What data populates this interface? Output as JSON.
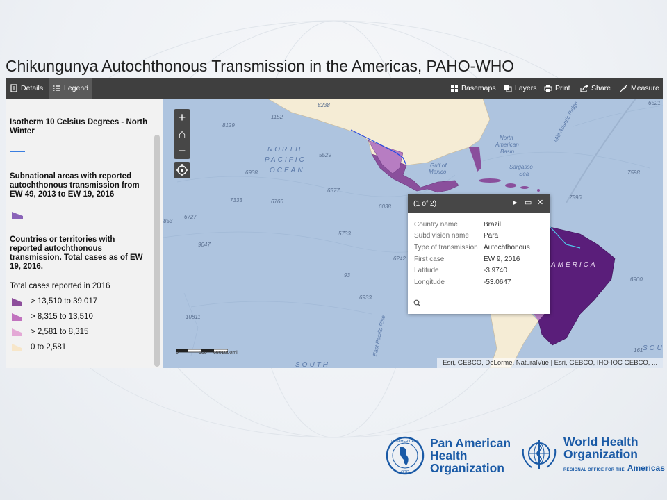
{
  "title": "Chikungunya Autochthonous Transmission in the Americas, PAHO-WHO",
  "toolbar": {
    "left": [
      {
        "label": "Details",
        "icon": "document-icon"
      },
      {
        "label": "Legend",
        "icon": "list-icon",
        "active": true
      }
    ],
    "right": [
      {
        "label": "Basemaps",
        "icon": "grid-icon"
      },
      {
        "label": "Layers",
        "icon": "layers-icon"
      },
      {
        "label": "Print",
        "icon": "printer-icon"
      },
      {
        "label": "Share",
        "icon": "share-icon"
      },
      {
        "label": "Measure",
        "icon": "ruler-icon"
      }
    ]
  },
  "legend": {
    "isotherm_title": "Isotherm 10 Celsius Degrees - North Winter",
    "isotherm_color": "#3a7ee0",
    "subnational_title": "Subnational areas with reported autochthonous transmission from EW 49, 2013 to EW 19, 2016",
    "subnational_color": "#8a63b8",
    "countries_title": "Countries or territories with reported autochthonous transmission. Total cases as of EW 19, 2016.",
    "total_cases_label": "Total cases reported in 2016",
    "classes": [
      {
        "label": "> 13,510 to 39,017",
        "color": "#8e4f9c"
      },
      {
        "label": "> 8,315 to 13,510",
        "color": "#c173be"
      },
      {
        "label": "> 2,581 to 8,315",
        "color": "#e4a9d6"
      },
      {
        "label": "0 to 2,581",
        "color": "#f7e6c9"
      }
    ]
  },
  "map": {
    "zoom_in": "+",
    "home": "⌂",
    "zoom_out": "−",
    "ocean_labels": [
      "NORTH",
      "PACIFIC",
      "OCEAN",
      "SOUTH"
    ],
    "land_labels": [
      "AMERICA",
      "SOU"
    ],
    "sea_labels": [
      "Gulf of",
      "Mexico",
      "Sargasso",
      "Sea",
      "North",
      "American",
      "Basin",
      "Mid-Atlantic Ridge",
      "East Pacific Rise"
    ],
    "depths": [
      "8238",
      "1152",
      "8129",
      "6521",
      "5529",
      "6938",
      "6377",
      "7333",
      "6766",
      "6038",
      "853",
      "6727",
      "5733",
      "9047",
      "7598",
      "7596",
      "6242",
      "93",
      "6933",
      "6900",
      "10811",
      "161"
    ],
    "popup": {
      "title": "(1 of 2)",
      "fields": [
        {
          "k": "Country name",
          "v": "Brazil"
        },
        {
          "k": "Subdivision name",
          "v": "Para"
        },
        {
          "k": "Type of transmission",
          "v": "Autochthonous"
        },
        {
          "k": "First case",
          "v": "EW 9, 2016"
        },
        {
          "k": "Latitude",
          "v": "-3.9740"
        },
        {
          "k": "Longitude",
          "v": "-53.0647"
        }
      ]
    },
    "scale": {
      "zero": "0",
      "mid": "500",
      "end": "6801000mi"
    },
    "attribution": "Esri, GEBCO, DeLorme, NaturalVue | Esri, GEBCO, IHO-IOC GEBCO, ..."
  },
  "logos": {
    "paho": [
      "Pan American",
      "Health",
      "Organization"
    ],
    "paho_seal": [
      "PANAMERICANA",
      "ORG"
    ],
    "who": [
      "World Health",
      "Organization"
    ],
    "who_sub": "REGIONAL OFFICE FOR THE",
    "who_region": "Americas"
  }
}
